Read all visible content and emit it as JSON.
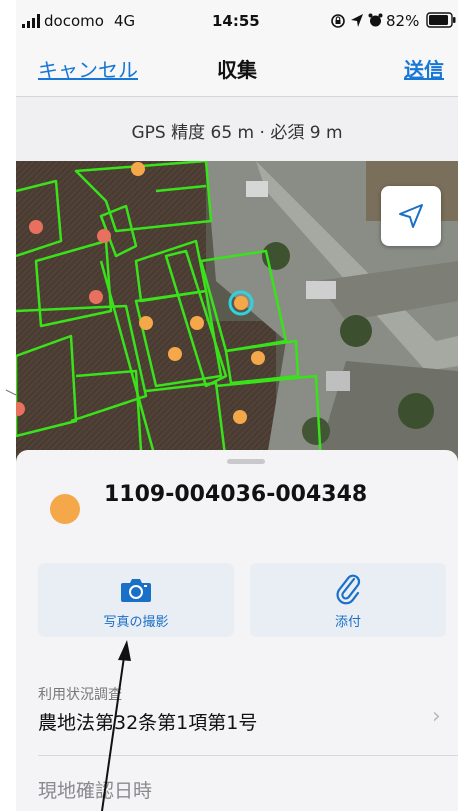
{
  "status_bar": {
    "carrier": "docomo",
    "network": "4G",
    "time": "14:55",
    "battery": "82%",
    "icons": [
      "signal-bars-icon",
      "screen-lock-icon",
      "location-arrow-icon",
      "alarm-icon",
      "battery-icon"
    ]
  },
  "nav": {
    "cancel": "キャンセル",
    "title": "収集",
    "send": "送信"
  },
  "gps": {
    "text": "GPS 精度 65 m · 必須 9 m"
  },
  "map": {
    "locate_icon": "location-arrow-icon",
    "parcel_outline_color": "#39e21b",
    "point_colors": {
      "orange": "#f4a84a",
      "red": "#e8705e",
      "selected_ring": "#2fd3e0"
    }
  },
  "feature": {
    "id": "1109-004036-004348",
    "symbol_color": "#f4a84a"
  },
  "actions": {
    "take_photo": "写真の撮影",
    "attach": "添付",
    "photo_icon": "camera-icon",
    "attach_icon": "paperclip-icon",
    "accent": "#1a6fc6"
  },
  "fields": {
    "usage_survey": {
      "label": "利用状況調査",
      "value": "農地法第32条第1項第1号"
    },
    "site_check_datetime": {
      "label": "現地確認日時"
    }
  }
}
